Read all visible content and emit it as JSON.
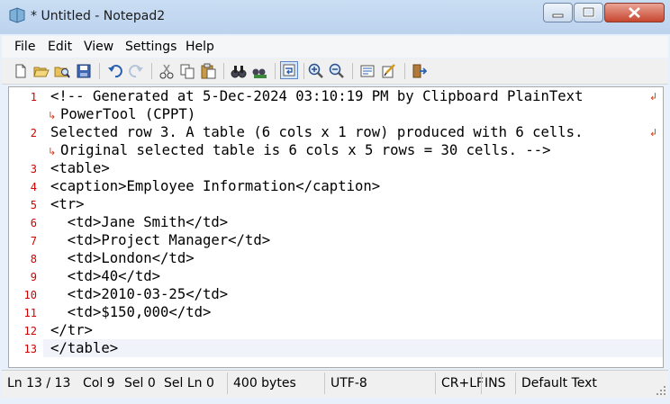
{
  "window": {
    "title": "* Untitled - Notepad2"
  },
  "menu": [
    "File",
    "Edit",
    "View",
    "Settings",
    "Help"
  ],
  "editor": {
    "lines": [
      {
        "num": "1",
        "text": "<!-- Generated at 5-Dec-2024 03:10:19 PM by Clipboard PlainText",
        "wrap": "PowerTool (CPPT)"
      },
      {
        "num": "2",
        "text": "Selected row 3. A table (6 cols x 1 row) produced with 6 cells.",
        "wrap": "Original selected table is 6 cols x 5 rows = 30 cells. -->"
      },
      {
        "num": "3",
        "text": "<table>"
      },
      {
        "num": "4",
        "text": "<caption>Employee Information</caption>"
      },
      {
        "num": "5",
        "text": "<tr>"
      },
      {
        "num": "6",
        "text": "  <td>Jane Smith</td>"
      },
      {
        "num": "7",
        "text": "  <td>Project Manager</td>"
      },
      {
        "num": "8",
        "text": "  <td>London</td>"
      },
      {
        "num": "9",
        "text": "  <td>40</td>"
      },
      {
        "num": "10",
        "text": "  <td>2010-03-25</td>"
      },
      {
        "num": "11",
        "text": "  <td>$150,000</td>"
      },
      {
        "num": "12",
        "text": "</tr>"
      },
      {
        "num": "13",
        "text": "</table>"
      }
    ]
  },
  "status": {
    "position": "Ln 13 / 13",
    "col": "Col 9",
    "sel": "Sel 0",
    "sel_ln": "Sel Ln 0",
    "size": "400 bytes",
    "encoding": "UTF-8",
    "eol": "CR+LF",
    "mode": "INS",
    "scheme": "Default Text"
  },
  "colors": {
    "line_number": "#d00000",
    "title_bar": "#c9ddf3",
    "close_button": "#c7472f"
  },
  "icons": [
    "app-icon",
    "new-icon",
    "open-icon",
    "browse-icon",
    "save-icon",
    "undo-icon",
    "redo-icon",
    "cut-icon",
    "copy-icon",
    "paste-icon",
    "find-icon",
    "replace-icon",
    "word-wrap-icon",
    "zoom-in-icon",
    "zoom-out-icon",
    "scheme-icon",
    "customize-icon",
    "exit-icon"
  ]
}
